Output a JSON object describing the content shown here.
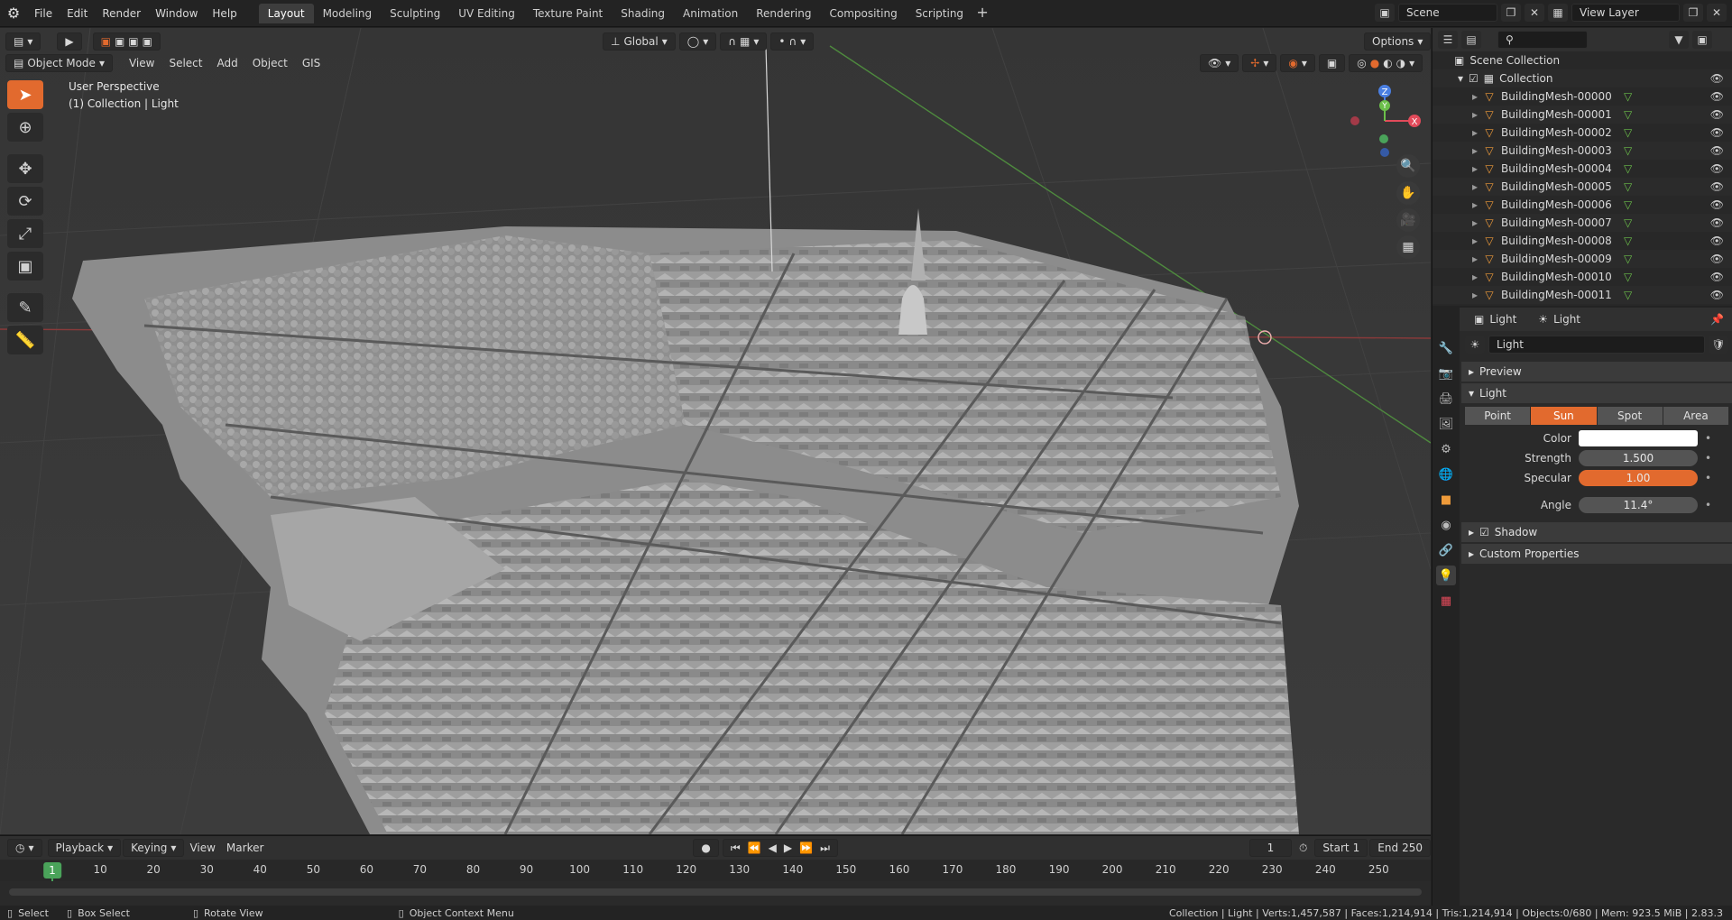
{
  "topbar": {
    "menus": [
      "File",
      "Edit",
      "Render",
      "Window",
      "Help"
    ],
    "workspaces": [
      "Layout",
      "Modeling",
      "Sculpting",
      "UV Editing",
      "Texture Paint",
      "Shading",
      "Animation",
      "Rendering",
      "Compositing",
      "Scripting"
    ],
    "active_workspace": "Layout",
    "add_tab": "+",
    "scene": "Scene",
    "view_layer": "View Layer"
  },
  "viewport": {
    "mode": "Object Mode",
    "menus": [
      "View",
      "Select",
      "Add",
      "Object",
      "GIS"
    ],
    "transform_orientation": "Global",
    "options_label": "Options",
    "overlay_title": "User Perspective",
    "overlay_subtitle": "(1) Collection | Light",
    "gizmo": {
      "z": "Z",
      "y": "Y",
      "x": "X"
    }
  },
  "timeline": {
    "menus": [
      "Playback",
      "Keying",
      "View",
      "Marker"
    ],
    "current_frame": "1",
    "start_label": "Start",
    "start_value": "1",
    "end_label": "End",
    "end_value": "250",
    "ticks": [
      "10",
      "20",
      "30",
      "40",
      "50",
      "60",
      "70",
      "80",
      "90",
      "100",
      "110",
      "120",
      "130",
      "140",
      "150",
      "160",
      "170",
      "180",
      "190",
      "200",
      "210",
      "220",
      "230",
      "240",
      "250"
    ],
    "playhead_label": "1"
  },
  "outliner": {
    "scene_collection": "Scene Collection",
    "collection": "Collection",
    "items": [
      "BuildingMesh-00000",
      "BuildingMesh-00001",
      "BuildingMesh-00002",
      "BuildingMesh-00003",
      "BuildingMesh-00004",
      "BuildingMesh-00005",
      "BuildingMesh-00006",
      "BuildingMesh-00007",
      "BuildingMesh-00008",
      "BuildingMesh-00009",
      "BuildingMesh-00010",
      "BuildingMesh-00011"
    ]
  },
  "properties": {
    "breadcrumb_object": "Light",
    "breadcrumb_data": "Light",
    "datablock_name": "Light",
    "panels": {
      "preview": "Preview",
      "light": "Light",
      "shadow": "Shadow",
      "custom_properties": "Custom Properties"
    },
    "light_types": [
      "Point",
      "Sun",
      "Spot",
      "Area"
    ],
    "active_light_type": "Sun",
    "color_label": "Color",
    "color_value": "#ffffff",
    "strength_label": "Strength",
    "strength_value": "1.500",
    "specular_label": "Specular",
    "specular_value": "1.00",
    "angle_label": "Angle",
    "angle_value": "11.4°"
  },
  "statusbar": {
    "select": "Select",
    "box_select": "Box Select",
    "rotate_view": "Rotate View",
    "context_menu": "Object Context Menu",
    "stats": "Collection | Light | Verts:1,457,587 | Faces:1,214,914 | Tris:1,214,914 | Objects:0/680 | Mem: 923.5 MiB | 2.83.3"
  },
  "colors": {
    "accent_orange": "#e26a2e",
    "frame_green": "#4aa35a",
    "mesh_orange": "#ef9b3a",
    "axis_x": "#e24a5a",
    "axis_y": "#6bbf4a",
    "axis_z": "#4a7fe2"
  }
}
